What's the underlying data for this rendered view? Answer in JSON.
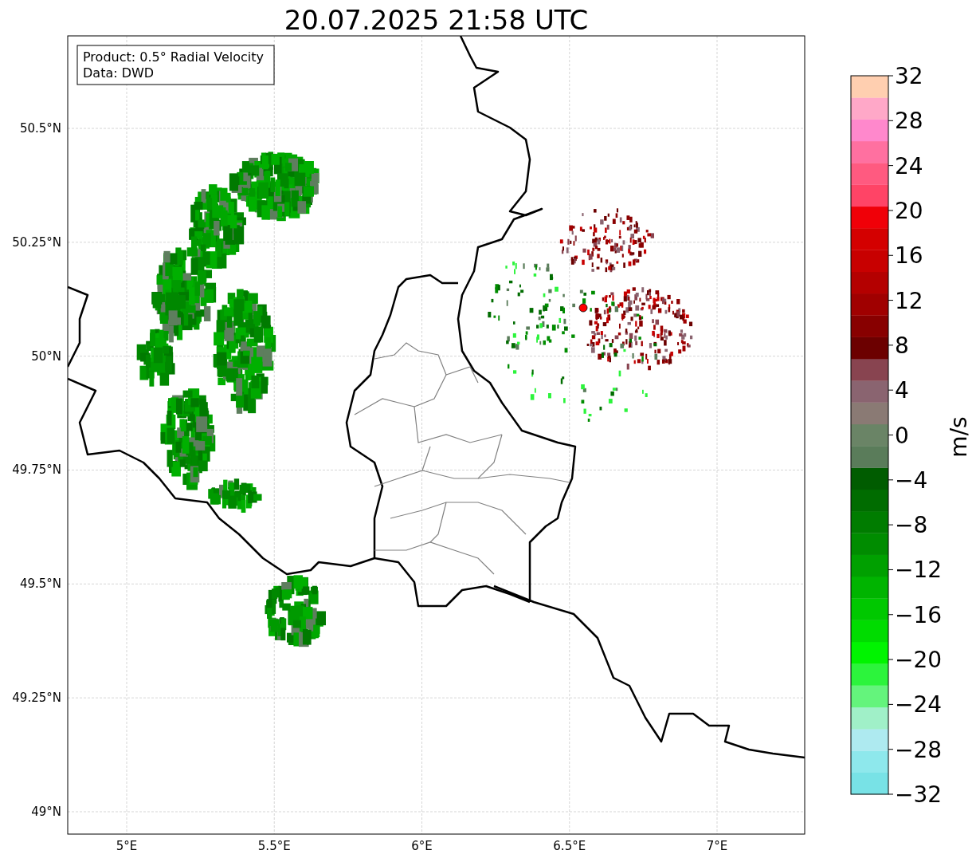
{
  "title": "20.07.2025 21:58 UTC",
  "legend": [
    "Product: 0.5° Radial Velocity",
    "Data: DWD"
  ],
  "lat_ticks": [
    "50.5°N",
    "50.25°N",
    "50°N",
    "49.75°N",
    "49.5°N",
    "49.25°N",
    "49°N"
  ],
  "lon_ticks": [
    "5°E",
    "5.5°E",
    "6°E",
    "6.5°E",
    "7°E"
  ],
  "colorbar": {
    "label": "m/s",
    "ticks": [
      "32",
      "28",
      "24",
      "20",
      "16",
      "12",
      "8",
      "4",
      "0",
      "−4",
      "−8",
      "−12",
      "−16",
      "−20",
      "−24",
      "−28",
      "−32"
    ],
    "segments": [
      {
        "color": "#78e2e6"
      },
      {
        "color": "#8ee8ec"
      },
      {
        "color": "#aeeaf0"
      },
      {
        "color": "#a0f0c8"
      },
      {
        "color": "#64f47c"
      },
      {
        "color": "#2cf43c"
      },
      {
        "color": "#00f400"
      },
      {
        "color": "#00dc00"
      },
      {
        "color": "#00c800"
      },
      {
        "color": "#00b400"
      },
      {
        "color": "#00a000"
      },
      {
        "color": "#008c00"
      },
      {
        "color": "#007c00"
      },
      {
        "color": "#006c00"
      },
      {
        "color": "#005c00"
      },
      {
        "color": "#5a7c5a"
      },
      {
        "color": "#6a8466"
      },
      {
        "color": "#8a7a74"
      },
      {
        "color": "#8a6470"
      },
      {
        "color": "#884450"
      },
      {
        "color": "#6c0000"
      },
      {
        "color": "#880000"
      },
      {
        "color": "#a00000"
      },
      {
        "color": "#b40000"
      },
      {
        "color": "#c80000"
      },
      {
        "color": "#d40000"
      },
      {
        "color": "#f00008"
      },
      {
        "color": "#ff4466"
      },
      {
        "color": "#ff5a80"
      },
      {
        "color": "#ff70a0"
      },
      {
        "color": "#ff88cc"
      },
      {
        "color": "#ffa8c8"
      },
      {
        "color": "#ffcfb0"
      }
    ]
  }
}
